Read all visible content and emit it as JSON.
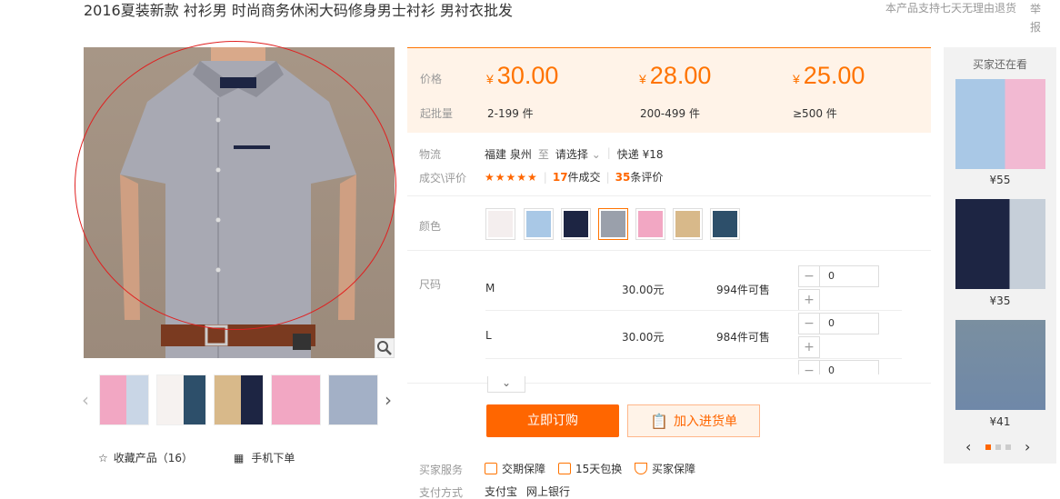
{
  "title": "2016夏装新款 衬衫男 时尚商务休闲大码修身男士衬衫 男衬衣批发",
  "top_note": "本产品支持七天无理由退货",
  "report": "举报",
  "gallery": {
    "favorite": "收藏产品（16）",
    "mobile_order": "手机下单"
  },
  "pricing": {
    "price_label": "价格",
    "moq_label": "起批量",
    "currency": "¥",
    "tiers": [
      {
        "price": "30.00",
        "range": "2-199 件"
      },
      {
        "price": "28.00",
        "range": "200-499 件"
      },
      {
        "price": "25.00",
        "range": "≥500 件"
      }
    ]
  },
  "logistics": {
    "label": "物流",
    "from": "福建 泉州",
    "to_label": "至",
    "to_select": "请选择",
    "express": "快递 ¥18"
  },
  "deals": {
    "label": "成交\\评价",
    "stars": "★★★★★",
    "sold_count": "17",
    "sold_text": "件成交",
    "review_count": "35",
    "review_text": "条评价"
  },
  "color": {
    "label": "颜色",
    "swatches": [
      "#f4eeee",
      "#a9c8e6",
      "#1d2543",
      "#9aa0ab",
      "#f2a7c3",
      "#d8b98a",
      "#2d4f6a"
    ],
    "selected_index": 3
  },
  "size": {
    "label": "尺码",
    "rows": [
      {
        "name": "M",
        "price": "30.00元",
        "stock": "994件可售",
        "qty": "0"
      },
      {
        "name": "L",
        "price": "30.00元",
        "stock": "984件可售",
        "qty": "0"
      },
      {
        "qty": "0"
      }
    ]
  },
  "actions": {
    "order": "立即订购",
    "cart": "加入进货单"
  },
  "service": {
    "label": "买家服务",
    "items": [
      "交期保障",
      "15天包换",
      "买家保障"
    ]
  },
  "payment": {
    "label": "支付方式",
    "methods": [
      "支付宝",
      "网上银行"
    ]
  },
  "side": {
    "title": "买家还在看",
    "items": [
      {
        "price": "¥55"
      },
      {
        "price": "¥35"
      },
      {
        "price": "¥41"
      }
    ]
  },
  "colors": {
    "accent": "#ff6600",
    "price_bg": "#fff3e8"
  }
}
